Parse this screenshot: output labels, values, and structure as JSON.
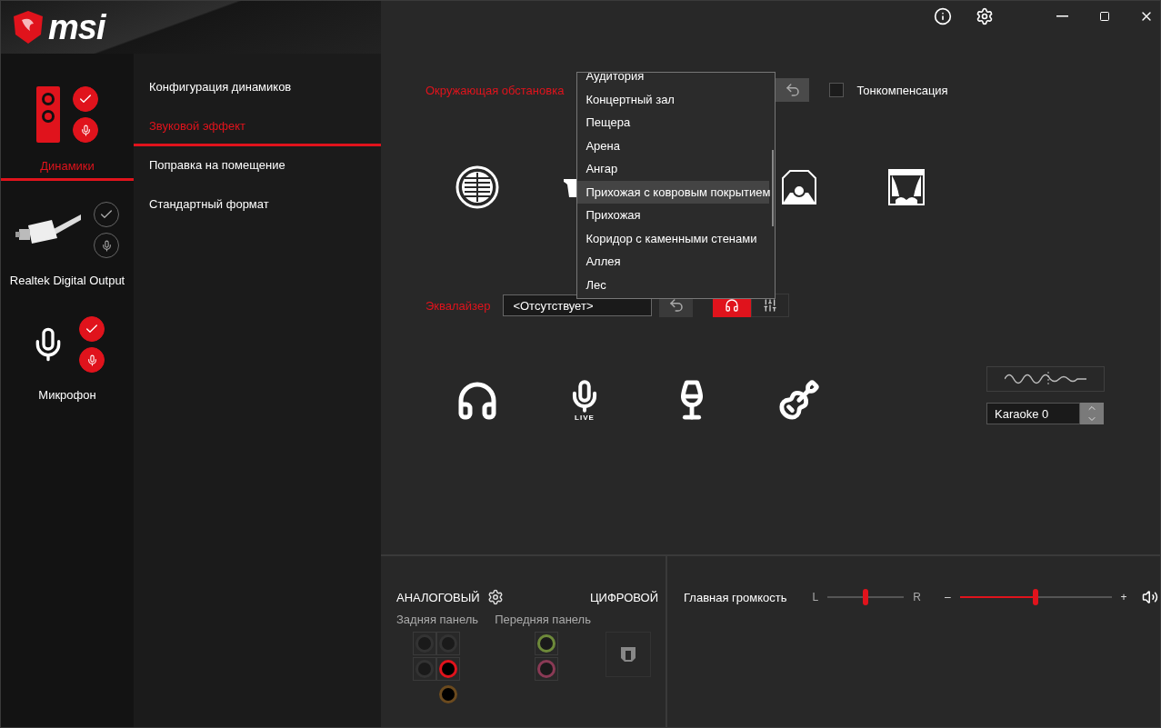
{
  "logo": {
    "text": "msi"
  },
  "devices": [
    {
      "name": "Динамики",
      "kind": "speaker",
      "selected": true,
      "default_on": true,
      "comm_on": true
    },
    {
      "name": "Realtek Digital Output",
      "kind": "optical",
      "selected": false,
      "default_on": false,
      "comm_on": false
    },
    {
      "name": "Микрофон",
      "kind": "mic",
      "selected": false,
      "default_on": true,
      "comm_on": true
    }
  ],
  "tabs": [
    {
      "label": "Конфигурация динамиков",
      "selected": false
    },
    {
      "label": "Звуковой эффект",
      "selected": true
    },
    {
      "label": "Поправка на помещение",
      "selected": false
    },
    {
      "label": "Стандартный формат",
      "selected": false
    }
  ],
  "environment": {
    "label": "Окружающая обстановка",
    "loudness": {
      "label": "Тонкомпенсация",
      "checked": false
    },
    "options": [
      {
        "label": "Аудитория",
        "selected": false
      },
      {
        "label": "Концертный зал",
        "selected": false
      },
      {
        "label": "Пещера",
        "selected": false
      },
      {
        "label": "Арена",
        "selected": false
      },
      {
        "label": "Ангар",
        "selected": false
      },
      {
        "label": "Прихожая с ковровым покрытием",
        "selected": true
      },
      {
        "label": "Прихожая",
        "selected": false
      },
      {
        "label": "Коридор с каменными стенами",
        "selected": false
      },
      {
        "label": "Аллея",
        "selected": false
      },
      {
        "label": "Лес",
        "selected": false
      }
    ]
  },
  "equalizer": {
    "label": "Эквалайзер",
    "value": "<Отсутствует>",
    "effect_on": true
  },
  "presets": {
    "live_label": "LIVE"
  },
  "karaoke": {
    "value": "Karaoke 0"
  },
  "connectors": {
    "analog_title": "АНАЛОГОВЫЙ",
    "digital_title": "ЦИФРОВОЙ",
    "rear_label": "Задняя панель",
    "front_label": "Передняя панель",
    "rear_jacks": [
      {
        "color": "#333333"
      },
      {
        "color": "#333333"
      },
      {
        "color": "#333333"
      },
      {
        "color": "#e0131c"
      },
      {
        "color": "#6b4a1e"
      }
    ],
    "front_jacks": [
      {
        "color": "#6e8a3a"
      },
      {
        "color": "#8a3a55"
      }
    ]
  },
  "volume": {
    "label": "Главная громкость",
    "left": "L",
    "right": "R",
    "balance": {
      "level": 0.5
    },
    "minus": "–",
    "plus": "+",
    "master": {
      "level": 0.5
    }
  }
}
